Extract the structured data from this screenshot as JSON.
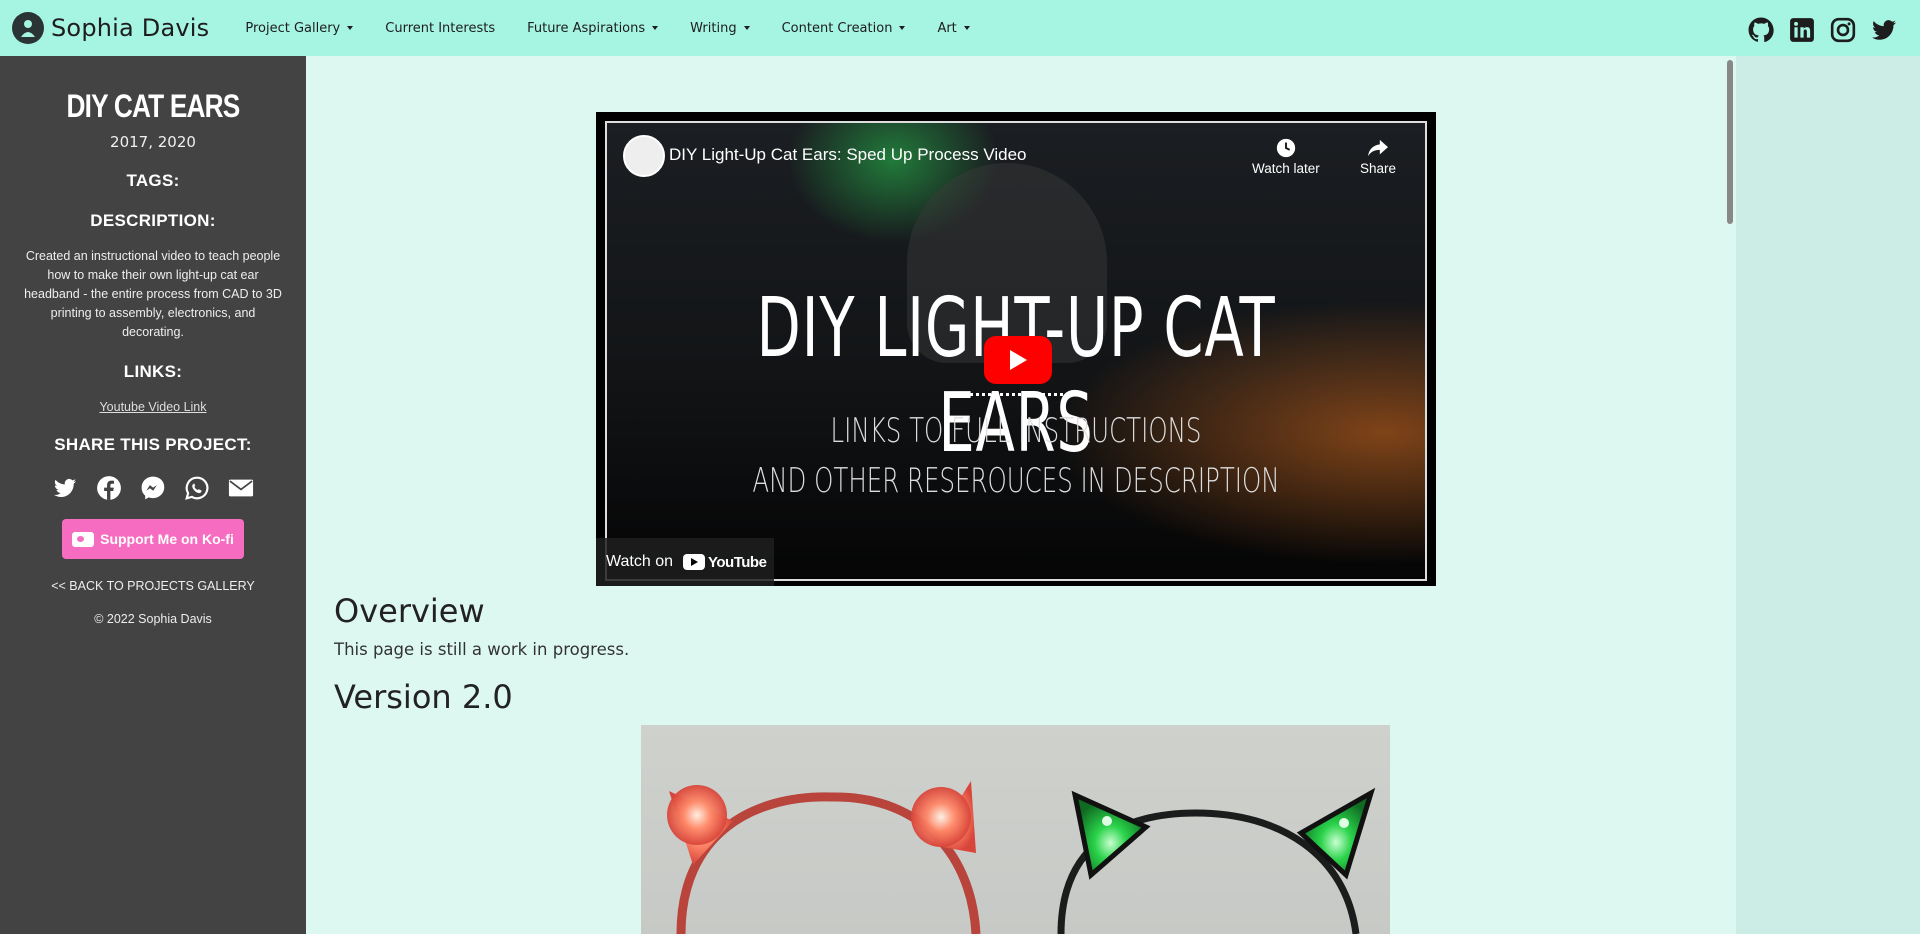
{
  "navbar": {
    "brand_name": "Sophia Davis",
    "items": [
      {
        "label": "Project Gallery",
        "dropdown": true
      },
      {
        "label": "Current Interests",
        "dropdown": false
      },
      {
        "label": "Future Aspirations",
        "dropdown": true
      },
      {
        "label": "Writing",
        "dropdown": true
      },
      {
        "label": "Content Creation",
        "dropdown": true
      },
      {
        "label": "Art",
        "dropdown": true
      }
    ],
    "social_icons": [
      "github-icon",
      "linkedin-icon",
      "instagram-icon",
      "twitter-icon"
    ],
    "background": "#a6f4e2"
  },
  "sidebar": {
    "title": "DIY CAT EARS",
    "years": "2017, 2020",
    "tags_heading": "TAGS:",
    "description_heading": "DESCRIPTION:",
    "description": "Created an instructional video to teach people how to make their own light-up cat ear headband - the entire process from CAD to 3D printing to assembly, electronics, and decorating.",
    "links_heading": "LINKS:",
    "youtube_link": "Youtube Video Link",
    "share_heading": "SHARE THIS PROJECT:",
    "share_icons": [
      "twitter-icon",
      "facebook-icon",
      "messenger-icon",
      "whatsapp-icon",
      "email-icon"
    ],
    "kofi_label": "Support Me on Ko-fi",
    "back_link": "<< BACK TO PROJECTS GALLERY",
    "copyright": "© 2022 Sophia Davis",
    "background": "#434343",
    "kofi_color": "#f56cc0"
  },
  "video": {
    "title": "DIY Light-Up Cat Ears: Sped Up Process Video",
    "watch_later": "Watch later",
    "share": "Share",
    "headline": "DIY LIGHT-UP CAT EARS",
    "subline_1": "LINKS TO FULL INSTRUCTIONS",
    "subline_2": "AND OTHER RESEROUCES IN DESCRIPTION",
    "watch_on": "Watch on",
    "youtube_wordmark": "YouTube"
  },
  "main": {
    "overview_heading": "Overview",
    "overview_text": "This page is still a work in progress.",
    "version_heading": "Version 2.0",
    "background": "#ddf7f1"
  }
}
